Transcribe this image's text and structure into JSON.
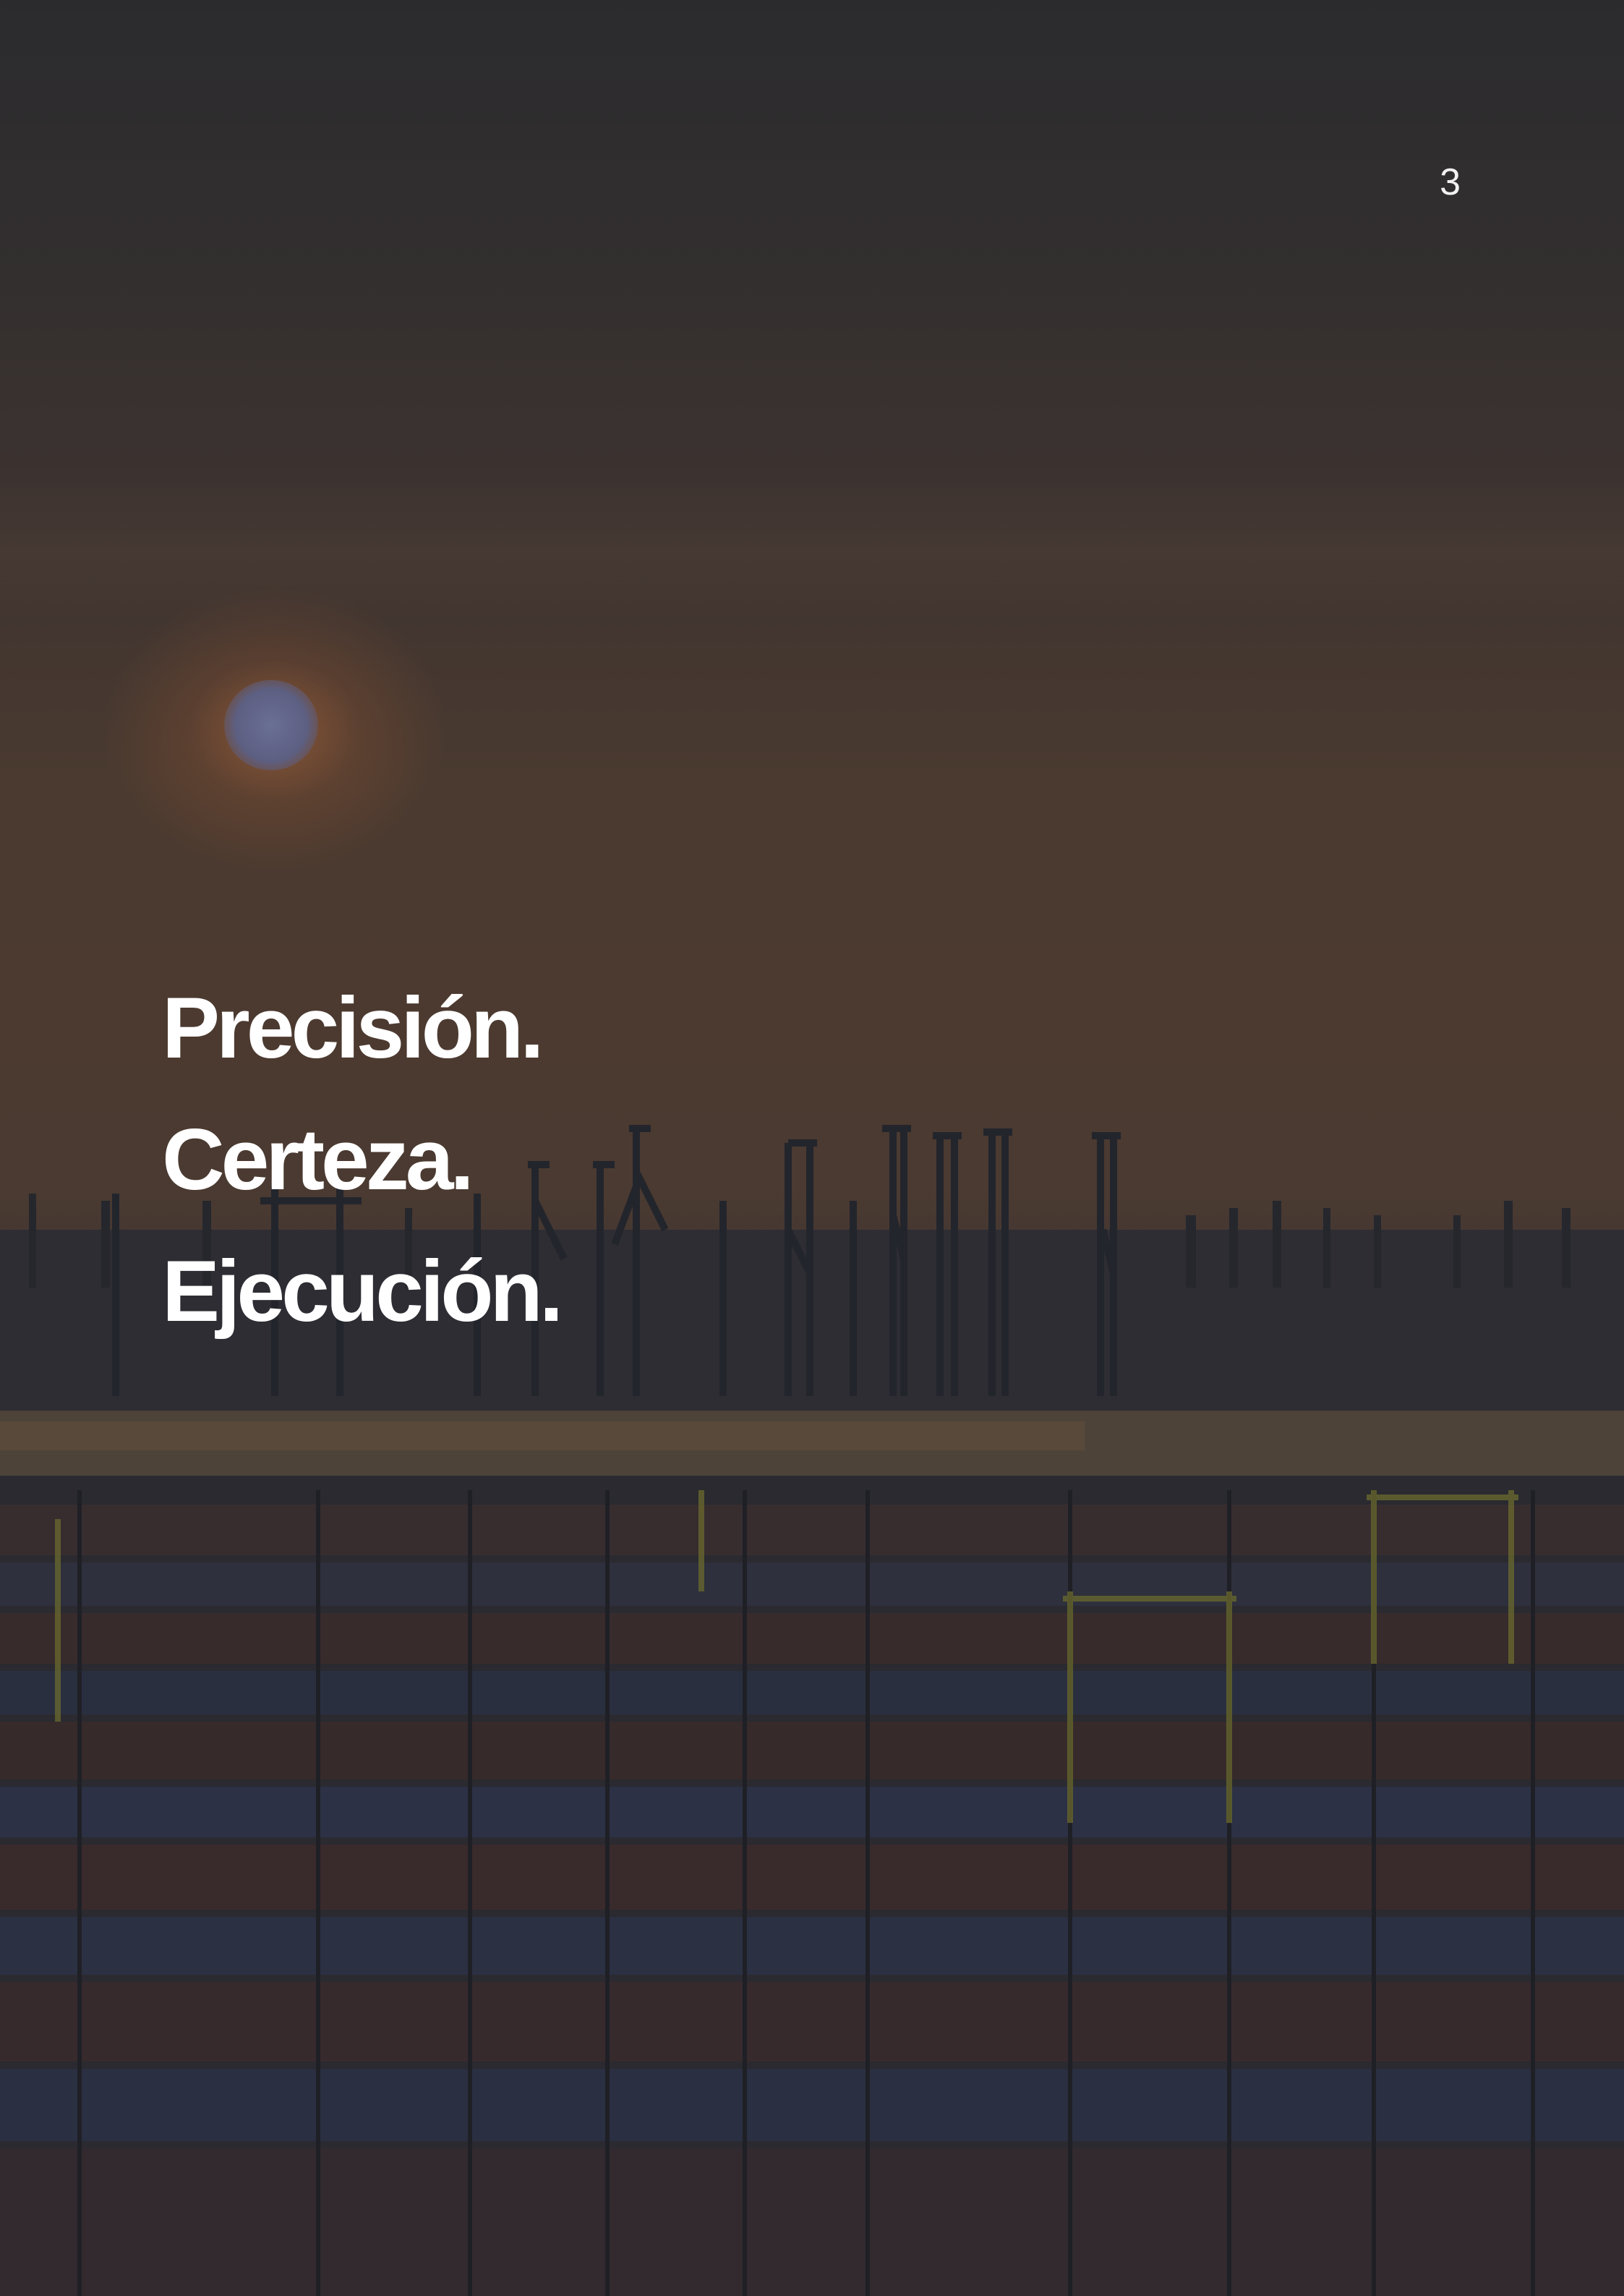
{
  "page": {
    "number": "3"
  },
  "headline": {
    "lines": [
      "Precisión.",
      "Certeza.",
      "Ejecución."
    ]
  },
  "background": {
    "description_icon": "port-container-terminal-photo",
    "colors": {
      "sky_top": "#2b2b2e",
      "sky_mid": "#4c3a30",
      "water": "#5a4a3a",
      "containers_dark": "#26272e"
    }
  }
}
